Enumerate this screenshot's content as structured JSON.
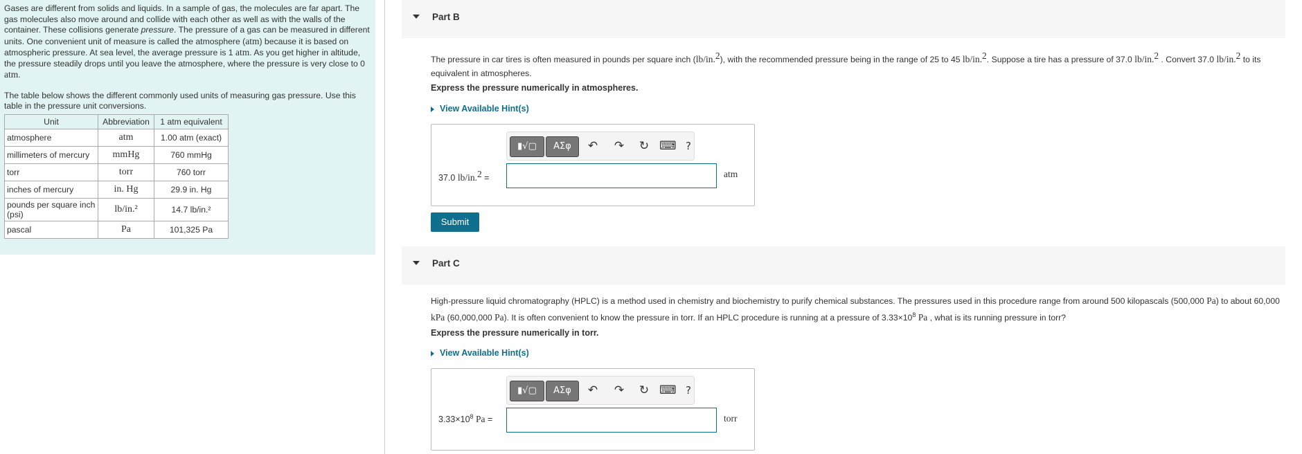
{
  "intro": {
    "p1_a": "Gases are different from solids and liquids. In a sample of gas, the molecules are far apart. The gas molecules also move around and collide with each other as well as with the walls of the container. These collisions generate ",
    "p1_em": "pressure",
    "p1_b": ". The pressure of a gas can be measured in different units. One convenient unit of measure is called the atmosphere (",
    "p1_atm": "atm",
    "p1_c": ") because it is based on atmospheric pressure. At sea level, the average pressure is 1 ",
    "p1_atm2": "atm",
    "p1_d": ". As you get higher in altitude, the pressure steadily drops until you leave the atmosphere, where the pressure is very close to 0 ",
    "p1_atm3": "atm",
    "p1_e": ".",
    "p2": "The table below shows the different commonly used units of measuring gas pressure. Use this table in the pressure unit conversions."
  },
  "table": {
    "headers": [
      "Unit",
      "Abbreviation",
      "1 atm equivalent"
    ],
    "rows": [
      [
        "atmosphere",
        "atm",
        "1.00 atm (exact)"
      ],
      [
        "millimeters of mercury",
        "mmHg",
        "760 mmHg"
      ],
      [
        "torr",
        "torr",
        "760 torr"
      ],
      [
        "inches of mercury",
        "in. Hg",
        "29.9 in. Hg"
      ],
      [
        "pounds per square inch (psi)",
        "lb/in.²",
        "14.7 lb/in.²"
      ],
      [
        "pascal",
        "Pa",
        "101,325 Pa"
      ]
    ]
  },
  "partB": {
    "title": "Part B",
    "q_a": "The pressure in car tires is often measured in pounds per square inch (",
    "q_u1": "lb/in.",
    "q_b": "), with the recommended pressure being in the range of 25 to 45 ",
    "q_u2": "lb/in.",
    "q_c": ". Suppose a tire has a pressure of 37.0 ",
    "q_u3": "lb/in.",
    "q_d": " . Convert 37.0 ",
    "q_u4": "lb/in.",
    "q_e": " to its equivalent in atmospheres.",
    "sq": "2",
    "express": "Express the pressure numerically in atmospheres.",
    "hint": "View Available Hint(s)",
    "ans_num": "37.0 ",
    "ans_unit_left": "lb/in.",
    "ans_eq": " =",
    "ans_unit_right": "atm",
    "submit": "Submit"
  },
  "partC": {
    "title": "Part C",
    "q_a": "High-pressure liquid chromatography (HPLC) is a method used in chemistry and biochemistry to purify chemical substances. The pressures used in this procedure range from around 500 kilopascals (500,000 ",
    "q_pa1": "Pa",
    "q_b": ") to about 60,000 ",
    "q_kpa": "kPa",
    "q_c": " (60,000,000 ",
    "q_pa2": "Pa",
    "q_d": "). It is often convenient to know the pressure in torr. If an HPLC procedure is running at a pressure of 3.33×10",
    "q_exp": "8",
    "q_pa3": " Pa",
    "q_e": " , what is its running pressure in torr?",
    "express": "Express the pressure numerically in torr.",
    "hint": "View Available Hint(s)",
    "ans_num": "3.33×10",
    "ans_exp": "8",
    "ans_unit_left": " Pa",
    "ans_eq": " =",
    "ans_unit_right": "torr"
  },
  "toolbar": {
    "templates_label": "▮√▢",
    "symbols_label": "ΑΣφ",
    "undo": "↶",
    "redo": "↷",
    "reset": "↻",
    "keyboard": "⌨",
    "help": "?"
  },
  "icons": {
    "collapse": "triangle-down-icon",
    "hint": "triangle-right-icon"
  },
  "colors": {
    "accent": "#0f6f8f",
    "intro_bg": "#e1f3f3",
    "header_bg": "#f6f6f6"
  }
}
